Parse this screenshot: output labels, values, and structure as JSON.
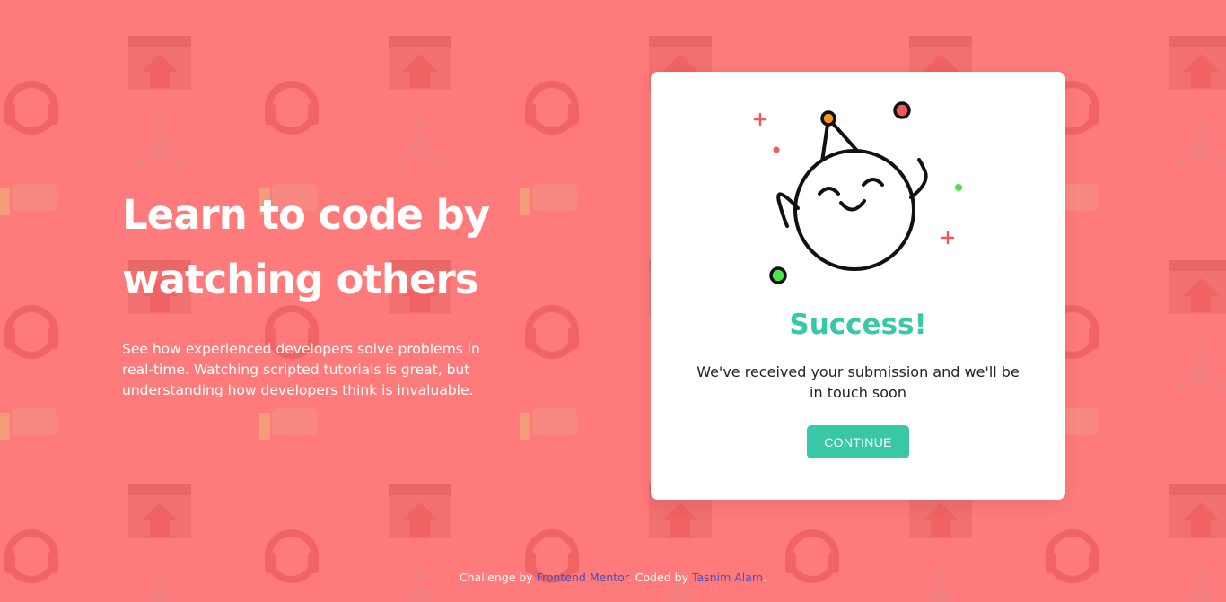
{
  "colors": {
    "background": "#ff7a7a",
    "accent": "#38c7a7",
    "card": "#ffffff",
    "link": "#4b4fbf"
  },
  "hero": {
    "title": "Learn to code by watching others",
    "text": "See how experienced developers solve problems in real-time. Watching scripted tutorials is great, but understanding how developers think is invaluable."
  },
  "modal": {
    "title": "Success!",
    "message": "We've received your submission and we'll be in touch soon",
    "button_label": "CONTINUE",
    "illustration": "happy-party-character-icon"
  },
  "footer": {
    "prefix": "Challenge by",
    "link1": "Frontend Mentor",
    "middle": ". Coded by",
    "link2": "Tasnim Alam",
    "suffix": "."
  }
}
